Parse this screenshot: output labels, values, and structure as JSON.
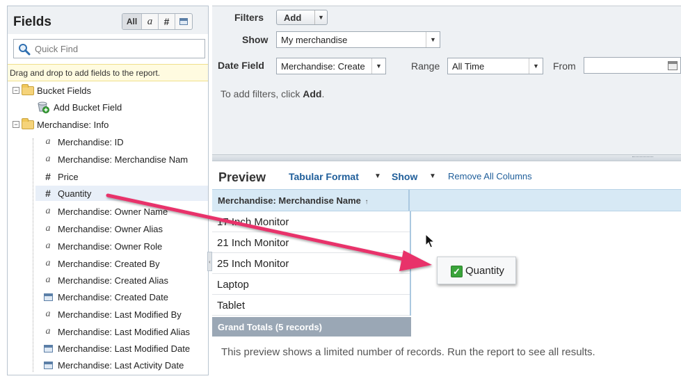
{
  "fields_panel": {
    "title": "Fields",
    "filter_buttons": [
      "All",
      "a",
      "#"
    ],
    "quick_find_placeholder": "Quick Find",
    "drag_hint": "Drag and drop to add fields to the report.",
    "tree": {
      "bucket_folder": "Bucket Fields",
      "add_bucket": "Add Bucket Field",
      "info_folder": "Merchandise: Info",
      "fields": [
        {
          "label": "Merchandise: ID",
          "type": "text"
        },
        {
          "label": "Merchandise: Merchandise Nam",
          "type": "text"
        },
        {
          "label": "Price",
          "type": "number"
        },
        {
          "label": "Quantity",
          "type": "number"
        },
        {
          "label": "Merchandise: Owner Name",
          "type": "text"
        },
        {
          "label": "Merchandise: Owner Alias",
          "type": "text"
        },
        {
          "label": "Merchandise: Owner Role",
          "type": "text"
        },
        {
          "label": "Merchandise: Created By",
          "type": "text"
        },
        {
          "label": "Merchandise: Created Alias",
          "type": "text"
        },
        {
          "label": "Merchandise: Created Date",
          "type": "date"
        },
        {
          "label": "Merchandise: Last Modified By",
          "type": "text"
        },
        {
          "label": "Merchandise: Last Modified Alias",
          "type": "text"
        },
        {
          "label": "Merchandise: Last Modified Date",
          "type": "date"
        },
        {
          "label": "Merchandise: Last Activity Date",
          "type": "date"
        }
      ]
    }
  },
  "filters": {
    "filters_label": "Filters",
    "add_label": "Add",
    "show_label": "Show",
    "show_value": "My merchandise",
    "date_field_label": "Date Field",
    "date_field_value": "Merchandise: Create",
    "range_label": "Range",
    "range_value": "All Time",
    "from_label": "From",
    "from_value": "",
    "hint_prefix": "To add filters, click ",
    "hint_action": "Add",
    "hint_suffix": "."
  },
  "preview": {
    "title": "Preview",
    "format_label": "Tabular Format",
    "show_label": "Show",
    "remove_label": "Remove All Columns",
    "column_header": "Merchandise: Merchandise Name",
    "sort_indicator": "↑",
    "rows": [
      "17 Inch Monitor",
      "21 Inch Monitor",
      "25 Inch Monitor",
      "Laptop",
      "Tablet"
    ],
    "totals": "Grand Totals (5 records)",
    "note": "This preview shows a limited number of records. Run the report to see all results."
  },
  "drag_chip": {
    "label": "Quantity"
  },
  "colors": {
    "accent_link": "#1f5e9a",
    "drag_arrow": "#e8336b",
    "check_green": "#3aa43a"
  }
}
